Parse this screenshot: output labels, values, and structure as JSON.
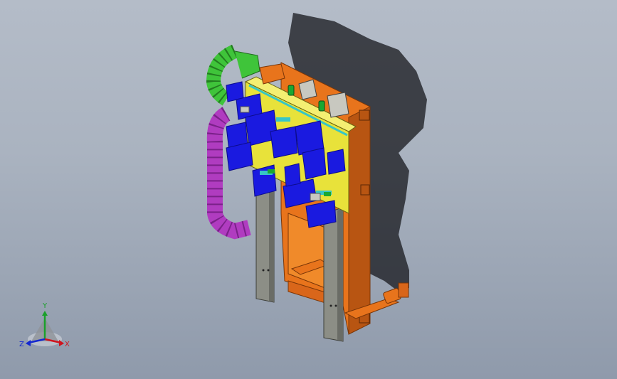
{
  "viewport": {
    "background_top": "#b4bcc8",
    "background_bottom": "#8f9aab"
  },
  "model": {
    "colors": {
      "frame_orange": "#e8741c",
      "frame_orange_dark": "#b85512",
      "plate_yellow": "#e8e23a",
      "clamp_blue": "#1a1ae0",
      "clamp_blue_dark": "#0c0c8c",
      "cable_chain_magenta": "#b03cc0",
      "cable_chain_green": "#3fc43a",
      "post_gray": "#8c8e86",
      "shadow": "#1c1e22",
      "cyan_rail": "#37c6c6",
      "green_pin": "#19a832"
    }
  },
  "triad": {
    "x_label": "X",
    "y_label": "Y",
    "z_label": "Z",
    "x_color": "#d0141e",
    "y_color": "#1aa02a",
    "z_color": "#1428d0"
  }
}
